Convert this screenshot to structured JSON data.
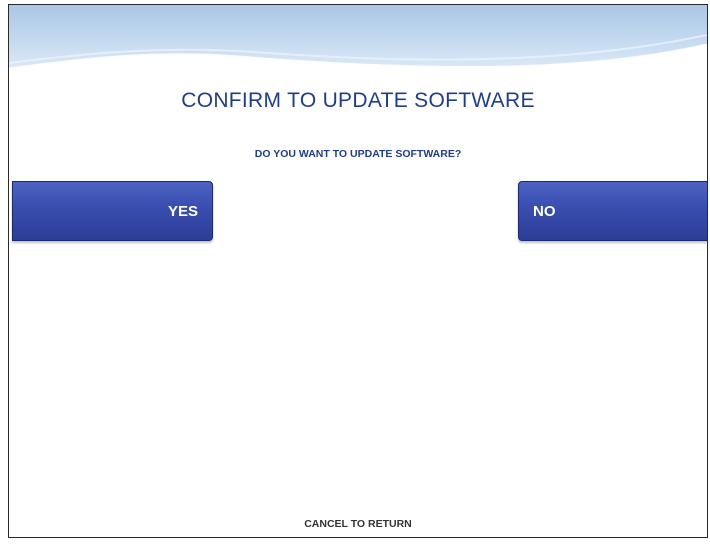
{
  "screen": {
    "title": "CONFIRM TO UPDATE SOFTWARE",
    "question": "DO YOU WANT TO UPDATE SOFTWARE?",
    "yes_label": "YES",
    "no_label": "NO",
    "footer": "CANCEL TO RETURN"
  },
  "colors": {
    "title": "#1f3d8f",
    "button": "#3a4fb1",
    "banner": "#bcd4ec"
  }
}
